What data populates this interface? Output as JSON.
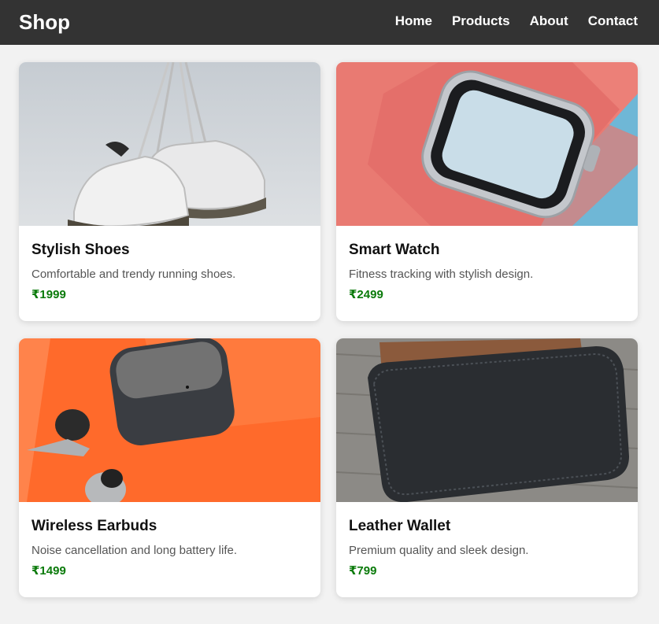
{
  "header": {
    "brand": "Shop",
    "nav": [
      "Home",
      "Products",
      "About",
      "Contact"
    ]
  },
  "products": [
    {
      "name": "Stylish Shoes",
      "description": "Comfortable and trendy running shoes.",
      "price": "₹1999",
      "image": "sneakers-hanging-photo"
    },
    {
      "name": "Smart Watch",
      "description": "Fitness tracking with stylish design.",
      "price": "₹2499",
      "image": "smartwatch-photo"
    },
    {
      "name": "Wireless Earbuds",
      "description": "Noise cancellation and long battery life.",
      "price": "₹1499",
      "image": "earbuds-case-photo"
    },
    {
      "name": "Leather Wallet",
      "description": "Premium quality and sleek design.",
      "price": "₹799",
      "image": "leather-wallet-photo"
    }
  ],
  "colors": {
    "header_bg": "#333333",
    "page_bg": "#f2f2f2",
    "price": "#0a7a0a"
  }
}
